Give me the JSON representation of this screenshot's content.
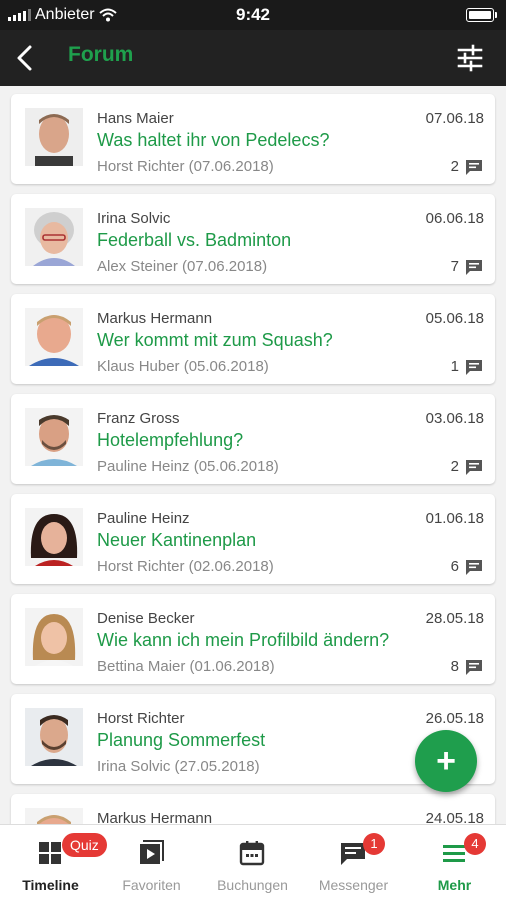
{
  "status_bar": {
    "carrier": "Anbieter",
    "time": "9:42"
  },
  "navbar": {
    "title": "Forum",
    "back_icon": "chevron-left-icon",
    "filter_icon": "sliders-icon"
  },
  "accent_color": "#1e9a48",
  "posts": [
    {
      "author": "Hans Maier",
      "title": "Was haltet ihr von Pedelecs?",
      "last_reply": "Horst Richter (07.06.2018)",
      "date": "07.06.18",
      "comments": "2"
    },
    {
      "author": "Irina Solvic",
      "title": "Federball vs. Badminton",
      "last_reply": "Alex Steiner (07.06.2018)",
      "date": "06.06.18",
      "comments": "7"
    },
    {
      "author": "Markus Hermann",
      "title": "Wer kommt mit zum Squash?",
      "last_reply": "Klaus Huber (05.06.2018)",
      "date": "05.06.18",
      "comments": "1"
    },
    {
      "author": "Franz Gross",
      "title": "Hotelempfehlung?",
      "last_reply": "Pauline Heinz (05.06.2018)",
      "date": "03.06.18",
      "comments": "2"
    },
    {
      "author": "Pauline Heinz",
      "title": "Neuer Kantinenplan",
      "last_reply": "Horst Richter (02.06.2018)",
      "date": "01.06.18",
      "comments": "6"
    },
    {
      "author": "Denise Becker",
      "title": "Wie kann ich mein Profilbild ändern?",
      "last_reply": "Bettina Maier (01.06.2018)",
      "date": "28.05.18",
      "comments": "8"
    },
    {
      "author": "Horst Richter",
      "title": "Planung Sommerfest",
      "last_reply": "Irina Solvic (27.05.2018)",
      "date": "26.05.18",
      "comments": ""
    },
    {
      "author": "Markus Hermann",
      "title": "",
      "last_reply": "",
      "date": "24.05.18",
      "comments": ""
    }
  ],
  "fab": {
    "label": "+"
  },
  "tabs": [
    {
      "label": "Timeline",
      "icon": "timeline-grid-icon",
      "badge": "Quiz"
    },
    {
      "label": "Favoriten",
      "icon": "favorites-play-icon",
      "badge": ""
    },
    {
      "label": "Buchungen",
      "icon": "calendar-icon",
      "badge": ""
    },
    {
      "label": "Messenger",
      "icon": "chat-icon",
      "badge": "1"
    },
    {
      "label": "Mehr",
      "icon": "menu-icon",
      "badge": "4"
    }
  ]
}
